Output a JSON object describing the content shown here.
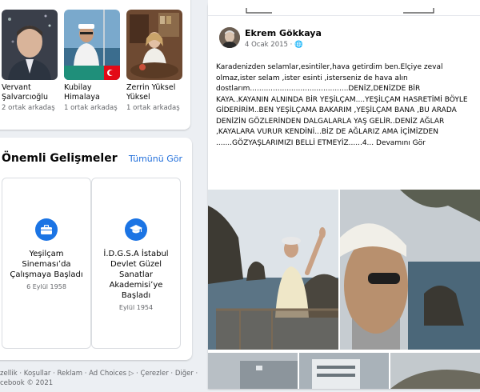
{
  "friends": [
    {
      "name": "Vervant Şalvarcıoğlu",
      "mutual": "2 ortak arkadaş"
    },
    {
      "name": "Kubilay Himalaya",
      "mutual": "1 ortak arkadaş"
    },
    {
      "name": "Zerrin Yüksel Yüksel",
      "mutual": "1 ortak arkadaş"
    }
  ],
  "events": {
    "title": "Önemli Gelişmeler",
    "see_all": "Tümünü Gör",
    "items": [
      {
        "title": "Yeşilçam Sinemasıʼda Çalışmaya Başladı",
        "date": "6 Eylül 1958",
        "icon": "briefcase-icon"
      },
      {
        "title": "İ.D.G.S.A İstabul Devlet Güzel Sanatlar Akademisiʼye Başladı",
        "date": "Eylül 1954",
        "icon": "graduation-cap-icon"
      }
    ]
  },
  "footer": {
    "links_line": "zellik · Koşullar · Reklam · Ad Choices ▷ · Çerezler · Diğer ·",
    "copyright": "cebook © 2021"
  },
  "post": {
    "author": "Ekrem Gökkaya",
    "date": "4 Ocak 2015 · 🌐",
    "text": "Karadenizden selamlar,esintiler,hava getirdim ben.Elçiye zeval olmaz,ister selam ,ister esinti ,isterseniz de hava alın dostlarım...........................................DENİZ,DENİZDE BİR KAYA..KAYANIN ALNINDA BİR YEŞİLÇAM....YEŞİLÇAM HASRETİMİ BÖYLE GİDERİRİM..BEN YEŞİLÇAMA BAKARIM ,YEŞİLÇAM BANA ,BU ARADA DENİZİN GÖZLERİNDEN  DALGALARLA YAŞ GELİR..DENİZ AĞLAR ,KAYALARA VURUR KENDİNİ...BİZ DE AĞLARIZ  AMA  İÇİMİZDEN .......GÖZYAŞLARIMIZI BELLİ ETMEYİZ......4...",
    "see_more": "Devamını Gör"
  },
  "colors": {
    "link": "#216fdb",
    "accent": "#1b74e4",
    "background": "#eceff3"
  }
}
